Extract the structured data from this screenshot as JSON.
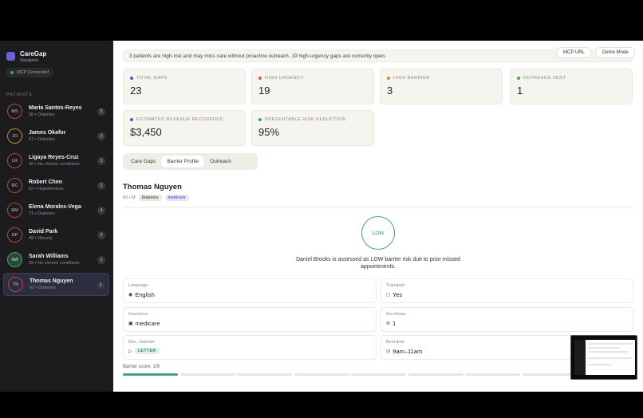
{
  "sidebar": {
    "brand_name": "CareGap",
    "brand_sub": "Navigator",
    "mcp_status": "MCP Connected",
    "patients_label": "PATIENTS",
    "patients": [
      {
        "initials": "MS",
        "name": "Maria Santos-Reyes",
        "meta": "58 • Diabetes",
        "count": "5",
        "risk": "high"
      },
      {
        "initials": "JO",
        "name": "James Okafor",
        "meta": "67 • Diabetes",
        "count": "3",
        "risk": "moderate"
      },
      {
        "initials": "LR",
        "name": "Ligaya Reyes-Cruz",
        "meta": "45 • No chronic conditions",
        "count": "3",
        "risk": "high"
      },
      {
        "initials": "RC",
        "name": "Robert Chen",
        "meta": "52 • Hypertension",
        "count": "2",
        "risk": "high"
      },
      {
        "initials": "EM",
        "name": "Elena Morales-Vega",
        "meta": "71 • Diabetes",
        "count": "4",
        "risk": "high"
      },
      {
        "initials": "DP",
        "name": "David Park",
        "meta": "48 • Obesity",
        "count": "2",
        "risk": "high"
      },
      {
        "initials": "SW",
        "name": "Sarah Williams",
        "meta": "39 • No chronic conditions",
        "count": "1",
        "risk": "low"
      },
      {
        "initials": "TN",
        "name": "Thomas Nguyen",
        "meta": "63 • Diabetes",
        "count": "3",
        "risk": "high"
      }
    ]
  },
  "topbar": {
    "mcp_url": "MCP URL",
    "demo_mode": "Demo Mode"
  },
  "alert": "3 patients are high-risk and may miss care without proactive outreach. 19 high-urgency gaps are currently open.",
  "stats": [
    {
      "label": "TOTAL GAPS",
      "value": "23",
      "color": "#5a52c8"
    },
    {
      "label": "HIGH URGENCY",
      "value": "19",
      "color": "#d0603a"
    },
    {
      "label": "HIGH BARRIER",
      "value": "3",
      "color": "#c98a2e"
    },
    {
      "label": "OUTREACH SENT",
      "value": "1",
      "color": "#3fa56a"
    },
    {
      "label": "ESTIMATED REVENUE RECOVERED",
      "value": "$3,450",
      "color": "#5a52c8"
    },
    {
      "label": "PREVENTABLE RISK REDUCTION",
      "value": "95%",
      "color": "#3fa56a"
    }
  ],
  "tabs": [
    "Care Gaps",
    "Barrier Profile",
    "Outreach"
  ],
  "patient": {
    "name": "Thomas Nguyen",
    "meta": "63 • M",
    "tags": [
      "Diabetes",
      "medicare"
    ],
    "risk_level": "LOW",
    "risk_text": "Daniel Brooks is assessed as LOW barrier risk due to prior missed appointments."
  },
  "fields": {
    "language": {
      "label": "Language",
      "value": "English",
      "icon": "◉"
    },
    "transport": {
      "label": "Transport",
      "value": "Yes",
      "icon": "◻"
    },
    "insurance": {
      "label": "Insurance",
      "value": "medicare",
      "icon": "▣"
    },
    "noshows": {
      "label": "No-shows",
      "value": "1",
      "icon": "⊘"
    },
    "channel": {
      "label": "Rec. channel",
      "value": "LETTER",
      "icon": "▷"
    },
    "besttime": {
      "label": "Best time",
      "value": "9am–11am",
      "icon": "◷"
    }
  },
  "barrier_score": {
    "label": "Barrier score: 1/9",
    "score": 1,
    "max": 9
  }
}
